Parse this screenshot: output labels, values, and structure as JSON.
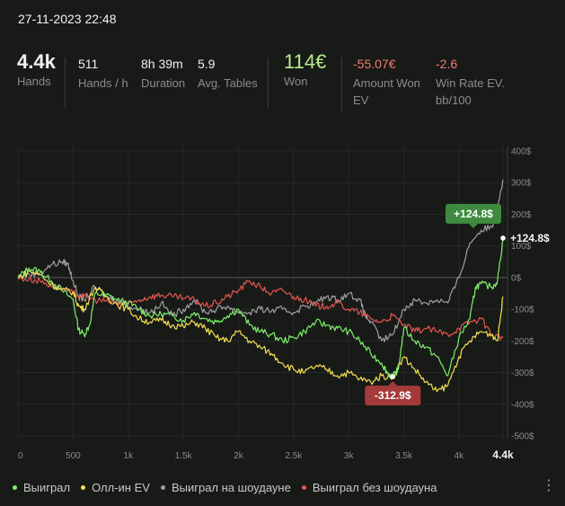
{
  "header": {
    "date": "27-11-2023 22:48"
  },
  "stats": [
    {
      "value": "4.4k",
      "label": "Hands"
    },
    {
      "value": "511",
      "label": "Hands / h"
    },
    {
      "value": "8h 39m",
      "label": "Duration"
    },
    {
      "value": "5.9",
      "label": "Avg. Tables"
    },
    {
      "value": "114€",
      "label": "Won"
    },
    {
      "value": "-55.07€",
      "label": "Amount Won EV"
    },
    {
      "value": "-2.6",
      "label": "Win Rate EV. bb/100"
    }
  ],
  "chart_data": {
    "type": "line",
    "x_ticks": [
      "0",
      "500",
      "1k",
      "1.5k",
      "2k",
      "2.5k",
      "3k",
      "3.5k",
      "4k",
      "4.4k"
    ],
    "x_tick_values": [
      0,
      500,
      1000,
      1500,
      2000,
      2500,
      3000,
      3500,
      4000,
      4400
    ],
    "y_ticks": [
      "400$",
      "300$",
      "200$",
      "100$",
      "0$",
      "-100$",
      "-200$",
      "-300$",
      "-400$",
      "-500$"
    ],
    "y_tick_values": [
      400,
      300,
      200,
      100,
      0,
      -100,
      -200,
      -300,
      -400,
      -500
    ],
    "xlim": [
      0,
      4400
    ],
    "ylim": [
      -500,
      400
    ],
    "annotations": [
      {
        "text": "+124.8$",
        "x": 4400,
        "y": 124.8,
        "color": "#3f8a3f"
      },
      {
        "text": "-312.9$",
        "x": 3400,
        "y": -312.9,
        "color": "#a53a3a"
      }
    ],
    "end_label": "+124.8$",
    "legend_position": "bottom-left",
    "series": [
      {
        "name": "Выиграл",
        "color": "#7ef06a",
        "points": [
          [
            0,
            0
          ],
          [
            100,
            30
          ],
          [
            200,
            20
          ],
          [
            300,
            -10
          ],
          [
            400,
            -40
          ],
          [
            500,
            -70
          ],
          [
            550,
            -165
          ],
          [
            600,
            -180
          ],
          [
            650,
            -150
          ],
          [
            700,
            -50
          ],
          [
            800,
            -55
          ],
          [
            900,
            -70
          ],
          [
            1000,
            -80
          ],
          [
            1100,
            -100
          ],
          [
            1200,
            -120
          ],
          [
            1300,
            -115
          ],
          [
            1400,
            -120
          ],
          [
            1500,
            -135
          ],
          [
            1600,
            -110
          ],
          [
            1700,
            -130
          ],
          [
            1800,
            -140
          ],
          [
            1900,
            -120
          ],
          [
            2000,
            -100
          ],
          [
            2100,
            -150
          ],
          [
            2200,
            -170
          ],
          [
            2300,
            -180
          ],
          [
            2400,
            -200
          ],
          [
            2500,
            -190
          ],
          [
            2600,
            -170
          ],
          [
            2700,
            -140
          ],
          [
            2800,
            -150
          ],
          [
            2900,
            -160
          ],
          [
            3000,
            -170
          ],
          [
            3100,
            -200
          ],
          [
            3200,
            -240
          ],
          [
            3300,
            -270
          ],
          [
            3350,
            -300
          ],
          [
            3400,
            -312.9
          ],
          [
            3450,
            -290
          ],
          [
            3500,
            -160
          ],
          [
            3600,
            -200
          ],
          [
            3700,
            -220
          ],
          [
            3800,
            -250
          ],
          [
            3900,
            -310
          ],
          [
            4000,
            -190
          ],
          [
            4100,
            -130
          ],
          [
            4150,
            -30
          ],
          [
            4200,
            -20
          ],
          [
            4300,
            -30
          ],
          [
            4350,
            -10
          ],
          [
            4400,
            124.8
          ]
        ]
      },
      {
        "name": "Олл-ин EV",
        "color": "#f4e050",
        "points": [
          [
            0,
            0
          ],
          [
            100,
            20
          ],
          [
            200,
            10
          ],
          [
            300,
            -20
          ],
          [
            400,
            -40
          ],
          [
            500,
            -45
          ],
          [
            550,
            -90
          ],
          [
            600,
            -100
          ],
          [
            700,
            -30
          ],
          [
            800,
            -60
          ],
          [
            900,
            -85
          ],
          [
            1000,
            -100
          ],
          [
            1100,
            -130
          ],
          [
            1200,
            -140
          ],
          [
            1300,
            -135
          ],
          [
            1400,
            -150
          ],
          [
            1500,
            -155
          ],
          [
            1600,
            -140
          ],
          [
            1700,
            -160
          ],
          [
            1800,
            -190
          ],
          [
            1900,
            -200
          ],
          [
            2000,
            -170
          ],
          [
            2100,
            -200
          ],
          [
            2200,
            -220
          ],
          [
            2300,
            -240
          ],
          [
            2400,
            -270
          ],
          [
            2500,
            -290
          ],
          [
            2600,
            -300
          ],
          [
            2700,
            -280
          ],
          [
            2800,
            -290
          ],
          [
            2900,
            -310
          ],
          [
            3000,
            -300
          ],
          [
            3100,
            -320
          ],
          [
            3200,
            -330
          ],
          [
            3300,
            -310
          ],
          [
            3400,
            -315
          ],
          [
            3500,
            -250
          ],
          [
            3600,
            -290
          ],
          [
            3700,
            -330
          ],
          [
            3800,
            -360
          ],
          [
            3900,
            -340
          ],
          [
            4000,
            -250
          ],
          [
            4100,
            -200
          ],
          [
            4200,
            -170
          ],
          [
            4300,
            -180
          ],
          [
            4350,
            -200
          ],
          [
            4400,
            -60
          ]
        ]
      },
      {
        "name": "Выиграл на шоудауне",
        "color": "#9e9e9e",
        "points": [
          [
            0,
            0
          ],
          [
            100,
            10
          ],
          [
            200,
            15
          ],
          [
            300,
            40
          ],
          [
            400,
            50
          ],
          [
            450,
            45
          ],
          [
            500,
            -10
          ],
          [
            550,
            -60
          ],
          [
            600,
            -70
          ],
          [
            700,
            -30
          ],
          [
            800,
            -60
          ],
          [
            900,
            -70
          ],
          [
            1000,
            -90
          ],
          [
            1100,
            -100
          ],
          [
            1200,
            -110
          ],
          [
            1300,
            -80
          ],
          [
            1400,
            -120
          ],
          [
            1500,
            -100
          ],
          [
            1600,
            -70
          ],
          [
            1700,
            -110
          ],
          [
            1800,
            -100
          ],
          [
            1900,
            -90
          ],
          [
            2000,
            -110
          ],
          [
            2100,
            -110
          ],
          [
            2200,
            -100
          ],
          [
            2300,
            -105
          ],
          [
            2400,
            -100
          ],
          [
            2500,
            -110
          ],
          [
            2600,
            -90
          ],
          [
            2700,
            -80
          ],
          [
            2800,
            -60
          ],
          [
            2900,
            -70
          ],
          [
            3000,
            -50
          ],
          [
            3100,
            -70
          ],
          [
            3150,
            -120
          ],
          [
            3200,
            -140
          ],
          [
            3300,
            -200
          ],
          [
            3400,
            -180
          ],
          [
            3500,
            -100
          ],
          [
            3600,
            -70
          ],
          [
            3700,
            -80
          ],
          [
            3800,
            -70
          ],
          [
            3900,
            -80
          ],
          [
            4000,
            0
          ],
          [
            4100,
            110
          ],
          [
            4200,
            150
          ],
          [
            4300,
            160
          ],
          [
            4350,
            230
          ],
          [
            4400,
            310
          ]
        ]
      },
      {
        "name": "Выиграл без шоудауна",
        "color": "#e2554f",
        "points": [
          [
            0,
            0
          ],
          [
            100,
            -5
          ],
          [
            200,
            -10
          ],
          [
            300,
            -25
          ],
          [
            400,
            -35
          ],
          [
            500,
            -50
          ],
          [
            600,
            -60
          ],
          [
            700,
            -70
          ],
          [
            800,
            -75
          ],
          [
            900,
            -80
          ],
          [
            1000,
            -85
          ],
          [
            1100,
            -70
          ],
          [
            1200,
            -60
          ],
          [
            1300,
            -55
          ],
          [
            1400,
            -60
          ],
          [
            1500,
            -65
          ],
          [
            1600,
            -70
          ],
          [
            1700,
            -90
          ],
          [
            1800,
            -80
          ],
          [
            1900,
            -60
          ],
          [
            2000,
            -40
          ],
          [
            2100,
            -10
          ],
          [
            2200,
            -30
          ],
          [
            2300,
            -50
          ],
          [
            2400,
            -40
          ],
          [
            2500,
            -60
          ],
          [
            2600,
            -70
          ],
          [
            2700,
            -90
          ],
          [
            2800,
            -90
          ],
          [
            2900,
            -80
          ],
          [
            3000,
            -100
          ],
          [
            3100,
            -110
          ],
          [
            3200,
            -130
          ],
          [
            3300,
            -140
          ],
          [
            3400,
            -120
          ],
          [
            3500,
            -150
          ],
          [
            3600,
            -170
          ],
          [
            3700,
            -160
          ],
          [
            3800,
            -170
          ],
          [
            3900,
            -180
          ],
          [
            4000,
            -160
          ],
          [
            4100,
            -140
          ],
          [
            4200,
            -130
          ],
          [
            4300,
            -180
          ],
          [
            4400,
            -190
          ]
        ]
      }
    ]
  }
}
